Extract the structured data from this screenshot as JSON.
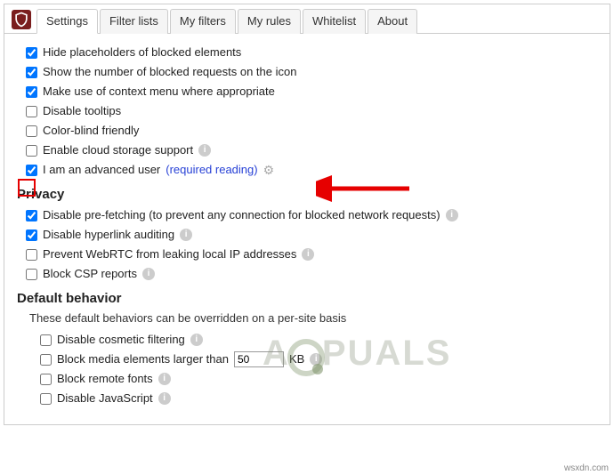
{
  "credit": "wsxdn.com",
  "tabs": {
    "settings": "Settings",
    "filter_lists": "Filter lists",
    "my_filters": "My filters",
    "my_rules": "My rules",
    "whitelist": "Whitelist",
    "about": "About"
  },
  "general": {
    "hide_placeholders": "Hide placeholders of blocked elements",
    "show_number": "Show the number of blocked requests on the icon",
    "context_menu": "Make use of context menu where appropriate",
    "disable_tooltips": "Disable tooltips",
    "color_blind": "Color-blind friendly",
    "cloud_storage": "Enable cloud storage support",
    "advanced_prefix": "I am an advanced user",
    "advanced_link": "(required reading)"
  },
  "privacy": {
    "heading": "Privacy",
    "prefetch": "Disable pre-fetching (to prevent any connection for blocked network requests)",
    "hyperlink": "Disable hyperlink auditing",
    "webrtc": "Prevent WebRTC from leaking local IP addresses",
    "csp": "Block CSP reports"
  },
  "default_behavior": {
    "heading": "Default behavior",
    "note": "These default behaviors can be overridden on a per-site basis",
    "cosmetic": "Disable cosmetic filtering",
    "media_prefix": "Block media elements larger than",
    "media_value": "50",
    "media_suffix": "KB",
    "remote_fonts": "Block remote fonts",
    "javascript": "Disable JavaScript"
  }
}
